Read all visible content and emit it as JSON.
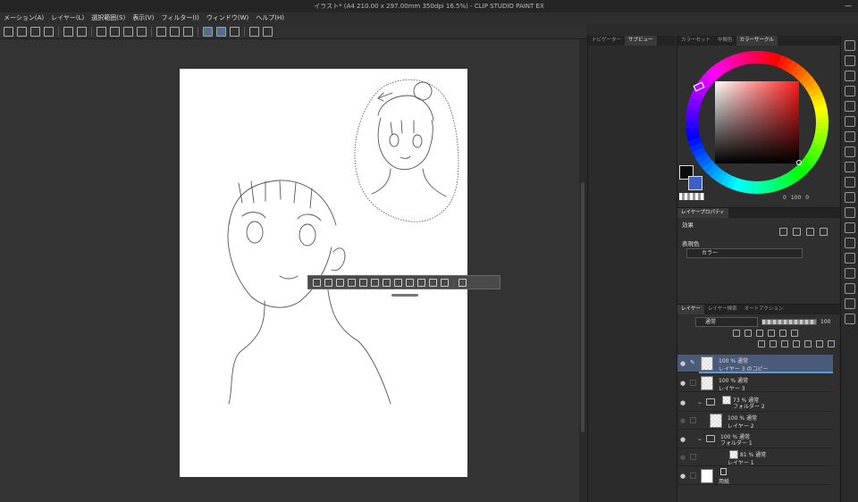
{
  "window": {
    "title": "イラスト* (A4 210.00 x 297.00mm 350dpi 16.5%) - CLIP STUDIO PAINT EX",
    "minimize": "—"
  },
  "menu": [
    "メーション(A)",
    "レイヤー(L)",
    "選択範囲(S)",
    "表示(V)",
    "フィルター(I)",
    "ウィンドウ(W)",
    "ヘルプ(H)"
  ],
  "nav_tabs": [
    "ナビゲーター",
    "サブビュー"
  ],
  "color_tabs": [
    "カラーセット",
    "中間色",
    "カラーサークル"
  ],
  "color": {
    "main_hex": "#0a0a0a",
    "sub_hex": "#3f5fc8",
    "readout_a": "0",
    "readout_b": "100",
    "readout_c": "0"
  },
  "property": {
    "tabs": [
      "レイヤープロパティ"
    ],
    "effect_label": "効果",
    "expression_color_label": "表現色",
    "expression_color_value": "カラー"
  },
  "layer_panel": {
    "tabs": [
      "レイヤー",
      "レイヤー検索",
      "オートアクション"
    ],
    "blend_mode": "通常",
    "opacity": "100",
    "layers": [
      {
        "blend": "100 % 通常",
        "name": "レイヤー 3 のコピー",
        "indent": 0,
        "kind": "raster",
        "selected": true
      },
      {
        "blend": "100 % 通常",
        "name": "レイヤー 3",
        "indent": 0,
        "kind": "raster",
        "selected": false
      },
      {
        "blend": "73 % 通常",
        "name": "フォルダー 2",
        "indent": 0,
        "kind": "folder",
        "selected": false
      },
      {
        "blend": "100 % 通常",
        "name": "レイヤー 2",
        "indent": 1,
        "kind": "raster",
        "selected": false
      },
      {
        "blend": "100 % 通常",
        "name": "フォルダー 1",
        "indent": 0,
        "kind": "folder",
        "selected": false
      },
      {
        "blend": "81 % 通常",
        "name": "レイヤー 1",
        "indent": 1,
        "kind": "raster",
        "selected": false
      },
      {
        "blend": "",
        "name": "用紙",
        "indent": 0,
        "kind": "paper",
        "selected": false
      }
    ]
  }
}
